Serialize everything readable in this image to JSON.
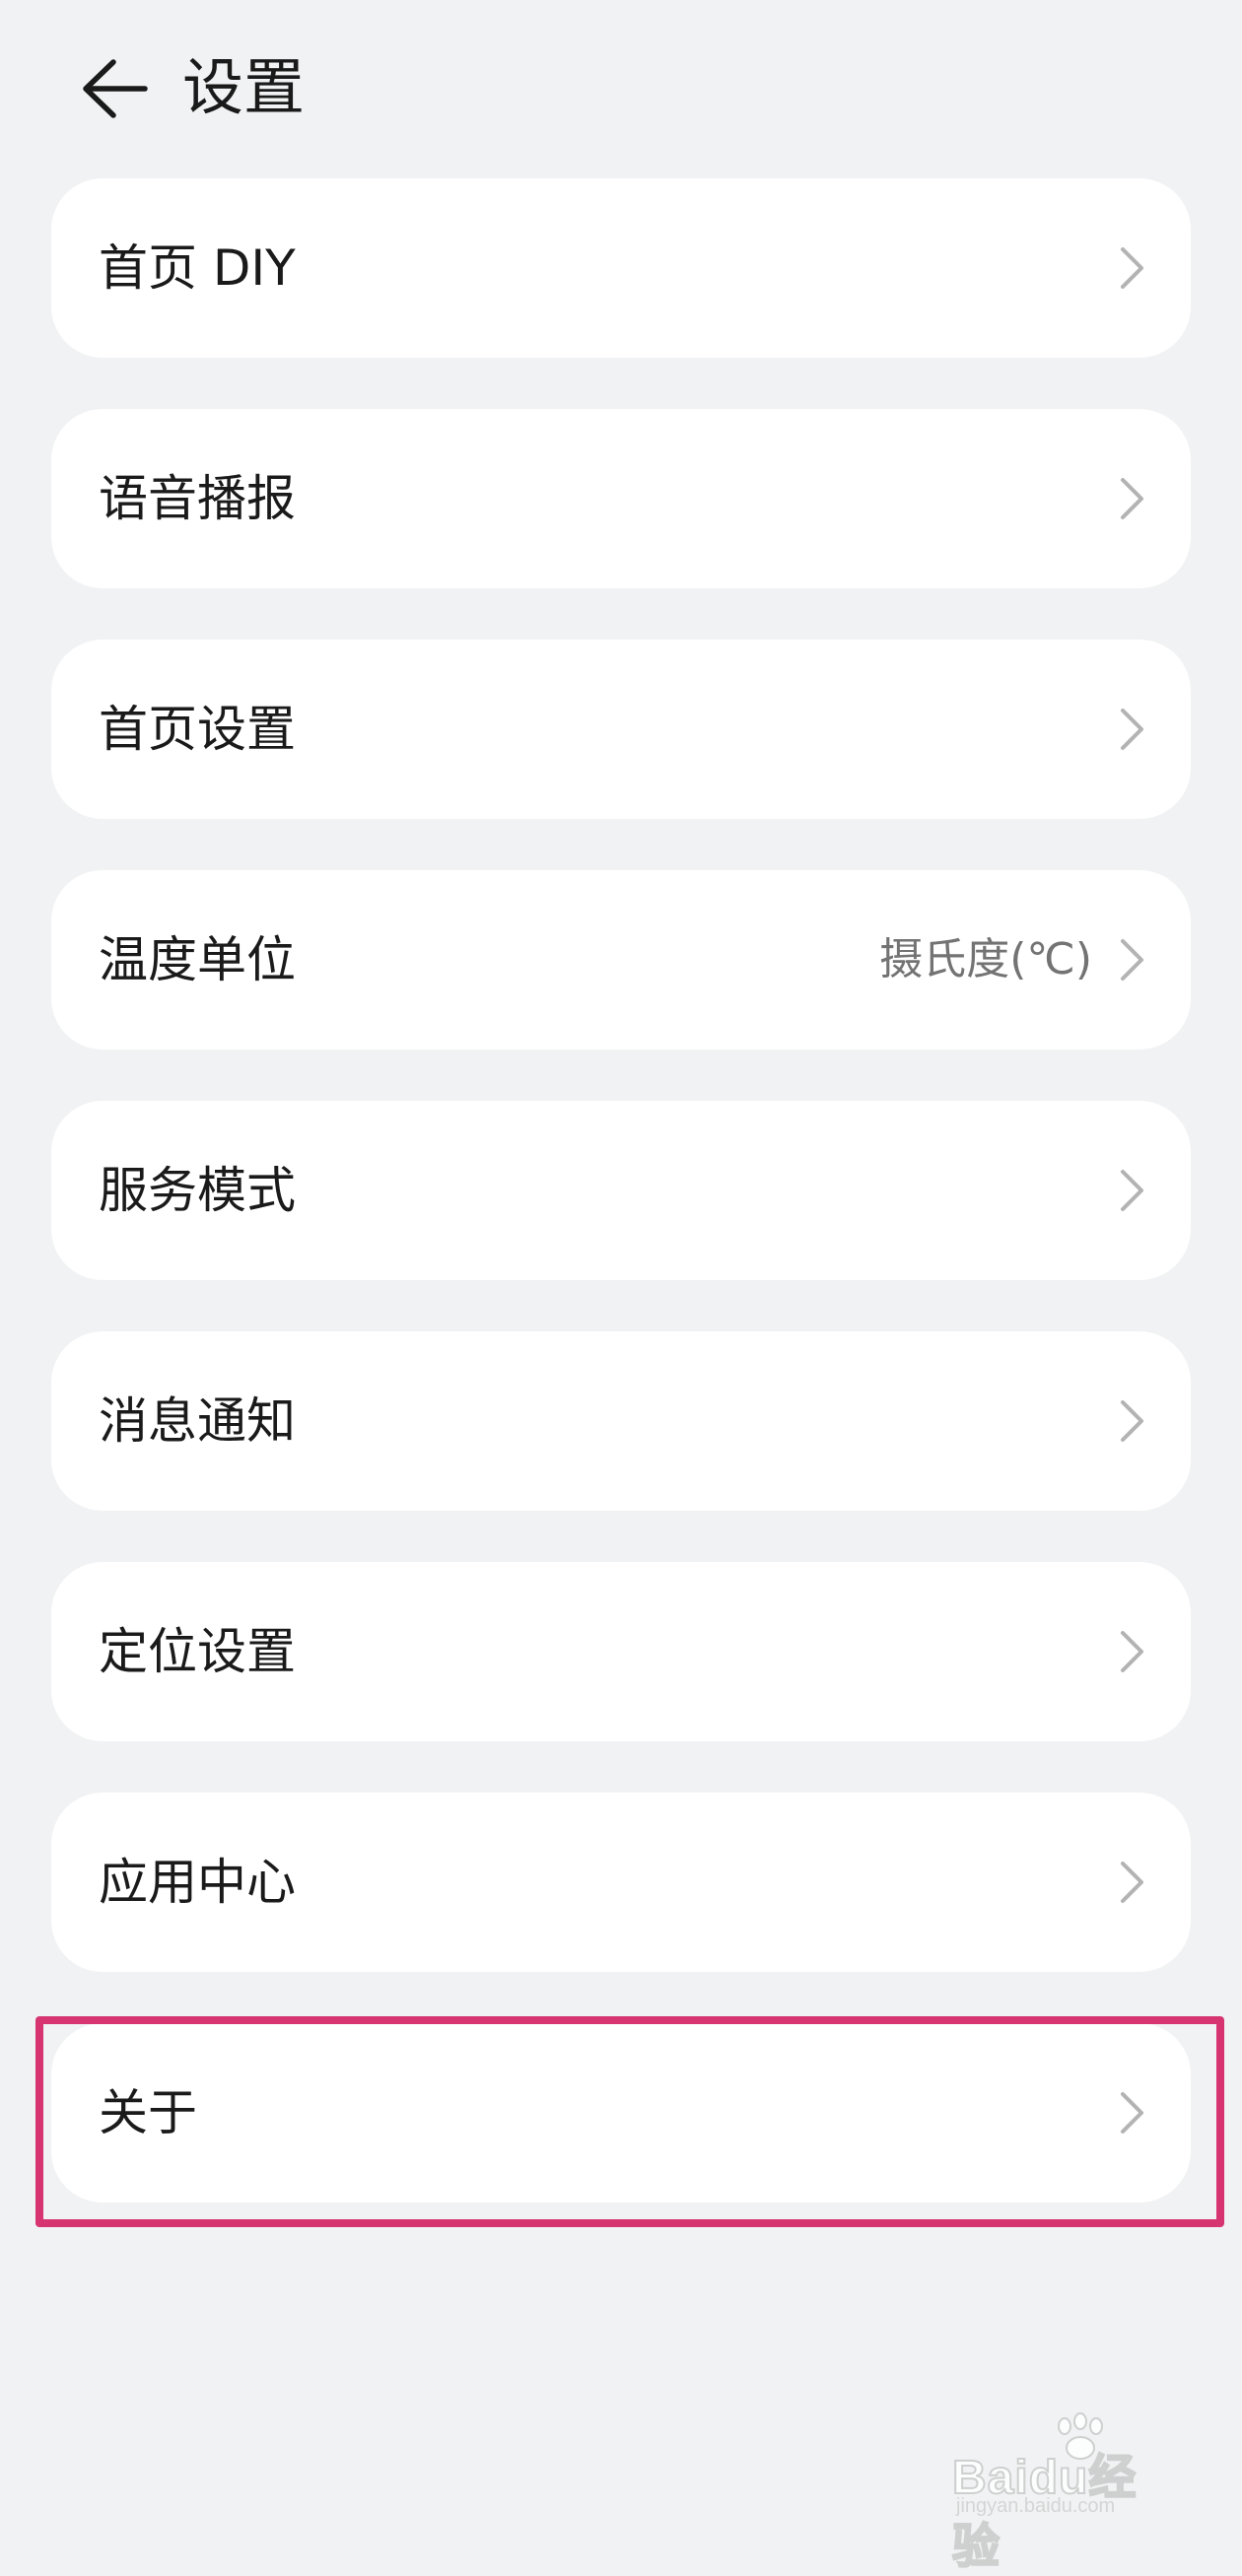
{
  "header": {
    "title": "设置",
    "back_icon": "arrow-left-icon"
  },
  "items": [
    {
      "label": "首页 DIY",
      "value": ""
    },
    {
      "label": "语音播报",
      "value": ""
    },
    {
      "label": "首页设置",
      "value": ""
    },
    {
      "label": "温度单位",
      "value": "摄氏度(℃)"
    },
    {
      "label": "服务模式",
      "value": ""
    },
    {
      "label": "消息通知",
      "value": ""
    },
    {
      "label": "定位设置",
      "value": ""
    },
    {
      "label": "应用中心",
      "value": ""
    },
    {
      "label": "关于",
      "value": ""
    }
  ],
  "highlight": {
    "color": "#d63571",
    "target_item": "关于"
  },
  "watermark": {
    "brand": "Baidu经验",
    "domain": "jingyan.baidu.com"
  },
  "colors": {
    "background": "#f1f2f3",
    "card": "#ffffff",
    "text": "#1a1a1a",
    "secondary_text": "#737373",
    "chevron": "#b3b3b3"
  }
}
